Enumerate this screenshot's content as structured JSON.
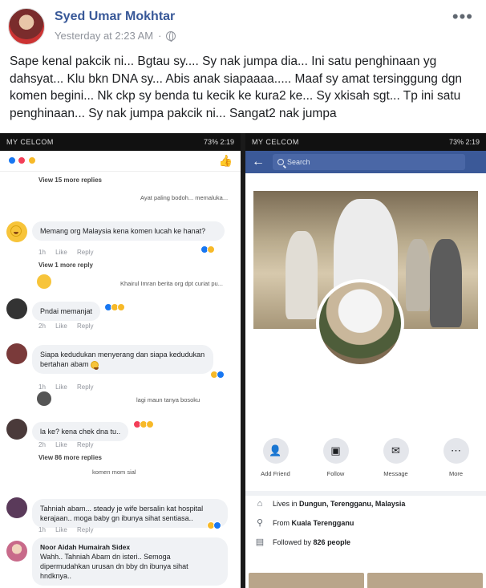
{
  "post": {
    "author": "Syed Umar Mokhtar",
    "timestamp": "Yesterday at 2:23 AM",
    "more": "•••",
    "text": "Sape kenal pakcik ni... Bgtau sy.... Sy nak jumpa dia... Ini satu penghinaan yg dahsyat... Klu bkn DNA sy... Abis anak siapaaaa..... Maaf sy amat tersinggung dgn komen begini... Nk ckp sy benda tu kecik ke kura2 ke... Sy xkisah sgt... Tp ini satu penghinaan... Sy nak jumpa pakcik ni... Sangat2 nak jumpa"
  },
  "left_phone": {
    "status_left": "MY CELCOM",
    "status_right": "73% 2:19",
    "view_more_1": "View 15 more replies",
    "reply_1": "Ayat paling bodoh... memaluka...",
    "comment_1": "Memang org Malaysia kena komen lucah ke hanat?",
    "actions_1": "1h Like Reply",
    "view_more_2": "View 1 more reply",
    "reply_2": "Khairul Imran berita org dpt curiat pu...",
    "comment_2": "Pndai memanjat",
    "actions_2": "2h Like Reply",
    "comment_3": "Siapa kedudukan menyerang dan siapa kedudukan bertahan abam",
    "actions_3": "1h Like Reply",
    "reply_3": "lagi maun tanya bosoku",
    "comment_4": "la ke? kena chek dna tu..",
    "actions_4": "2h Like Reply",
    "view_more_3": "View 86 more replies",
    "reply_4": "komen mom sial",
    "comment_5": "Tahniah abam... steady je wife bersalin kat hospital kerajaan.. moga baby gn ibunya sihat sentiasa..",
    "actions_5": "1h Like Reply",
    "comment_6_name": "Noor Aidah Humairah Sidex",
    "comment_6": "Wahh.. Tahniah Abam dn isteri.. Semoga dipermudahkan urusan dn bby dn ibunya sihat hndknya.."
  },
  "right_phone": {
    "status_left": "MY CELCOM",
    "status_right": "73% 2:19",
    "search_placeholder": "Search",
    "btn_add_friend": "Add Friend",
    "btn_follow": "Follow",
    "btn_message": "Message",
    "btn_more": "More",
    "lives_in_prefix": "Lives in",
    "lives_in": "Dungun, Terengganu, Malaysia",
    "from_prefix": "From",
    "from": "Kuala Terengganu",
    "followed_prefix": "Followed by",
    "followed": "826 people"
  }
}
